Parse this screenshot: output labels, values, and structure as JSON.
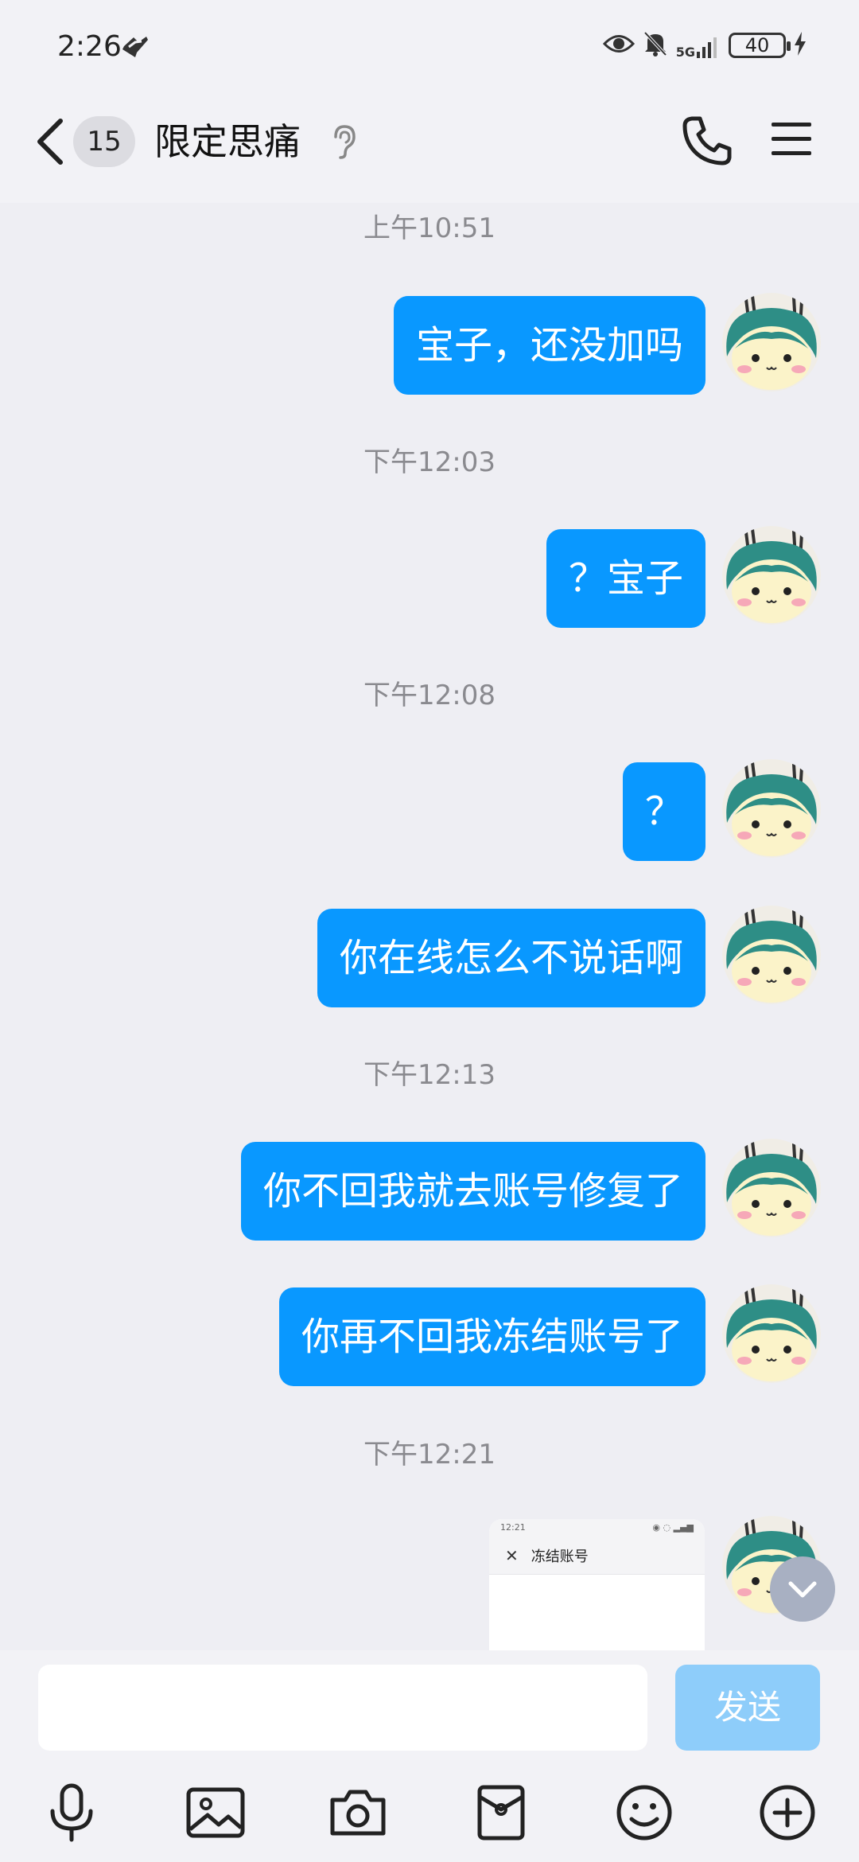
{
  "status_bar": {
    "time": "2:26",
    "network": "5G",
    "battery": "40"
  },
  "header": {
    "unread_count": "15",
    "title": "限定思痛"
  },
  "messages": [
    {
      "timestamp": "上午10:51",
      "text": "宝子，还没加吗"
    },
    {
      "timestamp": "下午12:03",
      "text": "？宝子"
    },
    {
      "timestamp": "下午12:08",
      "text": "？"
    },
    {
      "timestamp": "",
      "text": "你在线怎么不说话啊"
    },
    {
      "timestamp": "下午12:13",
      "text": "你不回我就去账号修复了"
    },
    {
      "timestamp": "",
      "text": "你再不回我冻结账号了"
    },
    {
      "timestamp": "下午12:21",
      "text": ""
    }
  ],
  "image_message": {
    "status_time": "12:21",
    "title": "冻结账号"
  },
  "input": {
    "placeholder": "",
    "send_label": "发送"
  },
  "toolbar": {
    "icons": [
      "microphone-icon",
      "image-icon",
      "camera-icon",
      "red-packet-icon",
      "emoji-icon",
      "plus-icon"
    ]
  },
  "colors": {
    "bubble": "#0998ff",
    "send_disabled": "#8ecdfa",
    "background": "#eeeef3"
  }
}
